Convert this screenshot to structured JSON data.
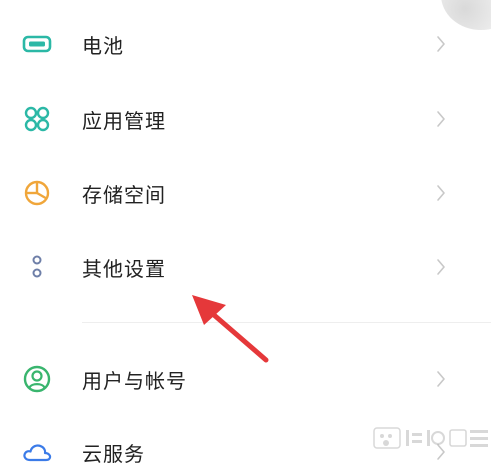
{
  "settings_list": {
    "items": [
      {
        "label": "电池",
        "icon": "battery-icon",
        "color": "#2bb8a6"
      },
      {
        "label": "应用管理",
        "icon": "app-grid-icon",
        "color": "#2bb8a6"
      },
      {
        "label": "存储空间",
        "icon": "storage-pie-icon",
        "color": "#f0a63a"
      },
      {
        "label": "其他设置",
        "icon": "more-settings-icon",
        "color": "#6e7fa8"
      },
      {
        "label": "用户与帐号",
        "icon": "user-account-icon",
        "color": "#39b56e"
      },
      {
        "label": "云服务",
        "icon": "cloud-icon",
        "color": "#3b7be8"
      }
    ]
  },
  "annotation": {
    "arrow_color": "#e5383a"
  },
  "watermark": {
    "logo": "baidu-jingyan-logo"
  }
}
